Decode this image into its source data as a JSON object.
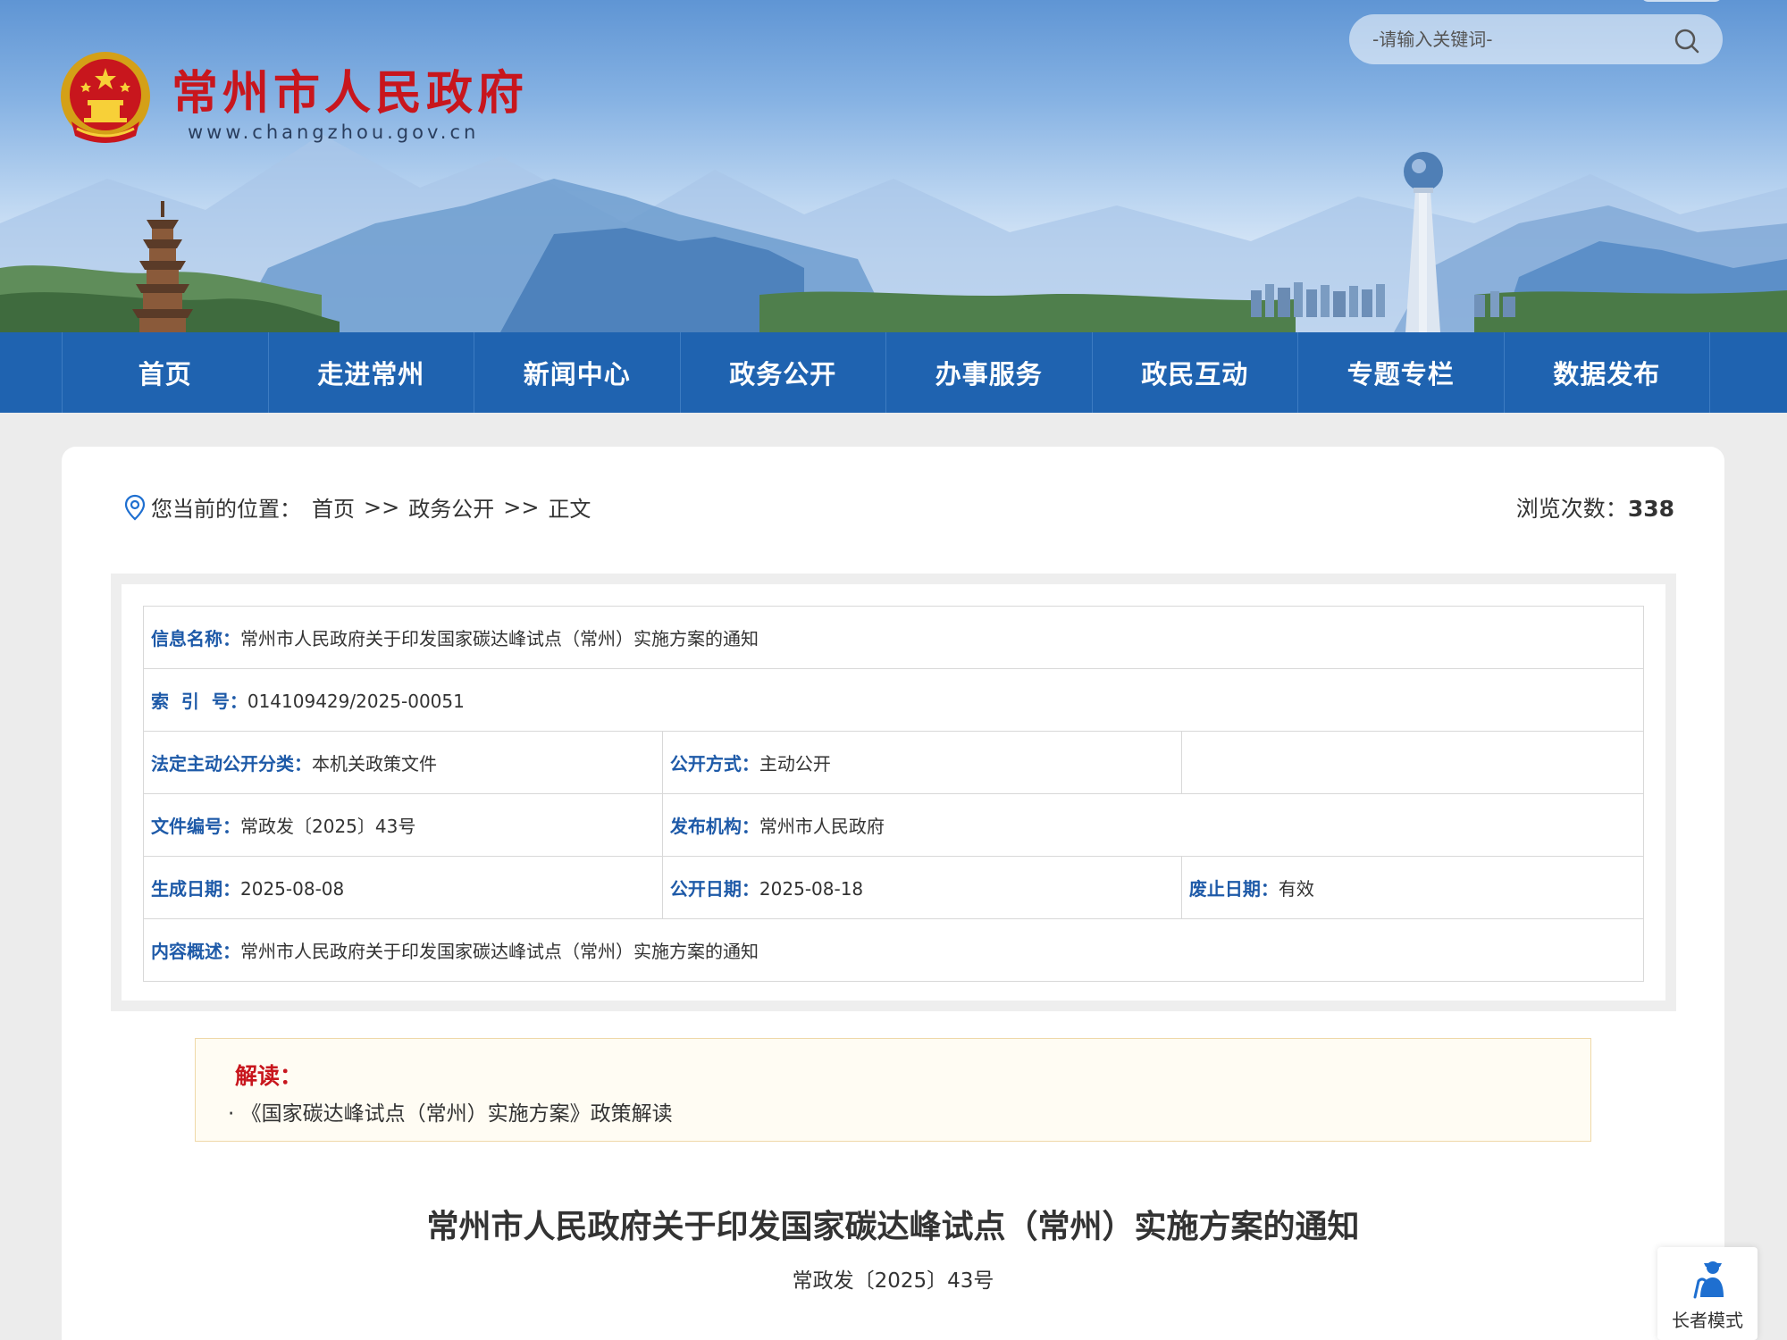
{
  "header": {
    "site_title": "常州市人民政府",
    "site_url": "www.changzhou.gov.cn",
    "search": {
      "placeholder": "-请输入关键词-",
      "value": ""
    }
  },
  "nav": {
    "items": [
      "首页",
      "走进常州",
      "新闻中心",
      "政务公开",
      "办事服务",
      "政民互动",
      "专题专栏",
      "数据发布"
    ]
  },
  "breadcrumb": {
    "prefix": "您当前的位置：",
    "items": [
      "首页",
      "政务公开",
      "正文"
    ],
    "separator": ">>"
  },
  "views": {
    "label": "浏览次数：",
    "count": "338"
  },
  "meta": {
    "info_name": {
      "label": "信息名称：",
      "value": "常州市人民政府关于印发国家碳达峰试点（常州）实施方案的通知"
    },
    "index_no": {
      "label": "索  引  号：",
      "value": "014109429/2025-00051"
    },
    "category": {
      "label": "法定主动公开分类：",
      "value": "本机关政策文件"
    },
    "disclosure_method": {
      "label": "公开方式：",
      "value": "主动公开"
    },
    "doc_number": {
      "label": "文件编号：",
      "value": "常政发〔2025〕43号"
    },
    "publisher": {
      "label": "发布机构：",
      "value": "常州市人民政府"
    },
    "created_date": {
      "label": "生成日期：",
      "value": "2025-08-08"
    },
    "publish_date": {
      "label": "公开日期：",
      "value": "2025-08-18"
    },
    "expiry_date": {
      "label": "废止日期：",
      "value": "有效"
    },
    "summary": {
      "label": "内容概述：",
      "value": "常州市人民政府关于印发国家碳达峰试点（常州）实施方案的通知"
    }
  },
  "interpretation": {
    "title": "解读：",
    "items": [
      "· 《国家碳达峰试点（常州）实施方案》政策解读"
    ]
  },
  "document": {
    "title": "常州市人民政府关于印发国家碳达峰试点（常州）实施方案的通知",
    "number": "常政发〔2025〕43号"
  },
  "elder_mode": {
    "label": "长者模式"
  },
  "colors": {
    "brand_red": "#c8161d",
    "nav_blue": "#1f63b0",
    "label_blue": "#1e5aa8"
  }
}
